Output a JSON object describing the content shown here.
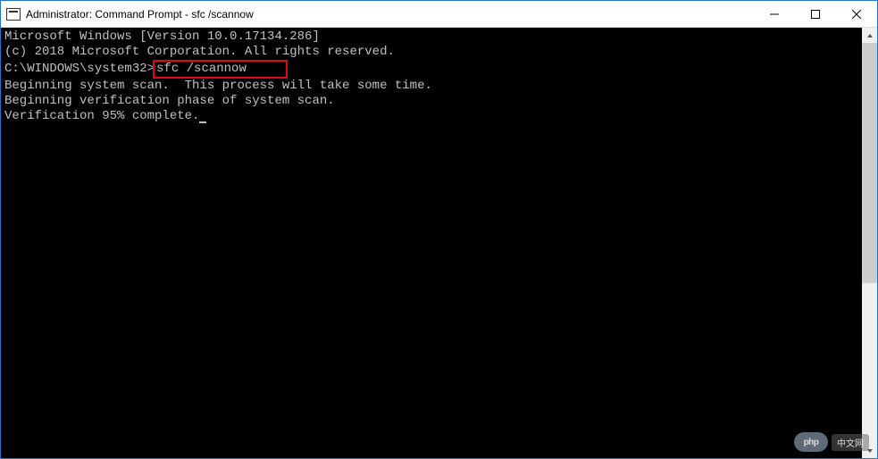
{
  "titlebar": {
    "title": "Administrator: Command Prompt - sfc  /scannow"
  },
  "terminal": {
    "line1": "Microsoft Windows [Version 10.0.17134.286]",
    "line2": "(c) 2018 Microsoft Corporation. All rights reserved.",
    "blank1": "",
    "prompt_prefix": "C:\\WINDOWS\\system32>",
    "command": "sfc /scannow",
    "blank2": "",
    "line4": "Beginning system scan.  This process will take some time.",
    "blank3": "",
    "line5": "Beginning verification phase of system scan.",
    "line6": "Verification 95% complete."
  },
  "watermark": {
    "logo": "php",
    "text": "中文网"
  }
}
